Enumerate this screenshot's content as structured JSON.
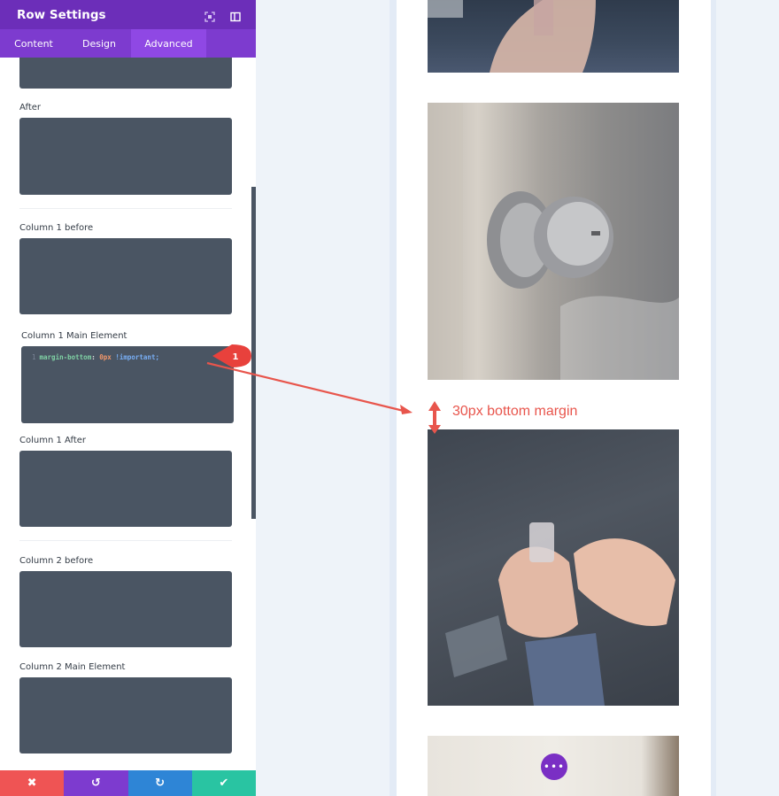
{
  "panel": {
    "title": "Row Settings",
    "header_icons": [
      "fullscreen-icon",
      "split-view-icon"
    ],
    "tabs": [
      {
        "label": "Content",
        "active": false
      },
      {
        "label": "Design",
        "active": false
      },
      {
        "label": "Advanced",
        "active": true
      }
    ],
    "fields": [
      {
        "label": "After",
        "value": ""
      },
      {
        "label": "Column 1 before",
        "value": ""
      },
      {
        "label": "Column 1 Main Element",
        "value": "margin-bottom: 0px !important;"
      },
      {
        "label": "Column 1 After",
        "value": ""
      },
      {
        "label": "Column 2 before",
        "value": ""
      },
      {
        "label": "Column 2 Main Element",
        "value": ""
      }
    ],
    "code": {
      "line_number": "1",
      "property": "margin-bottom",
      "colon": ":",
      "value": "0px",
      "important": "!important;"
    },
    "footer": {
      "cancel_icon": "✖",
      "undo_icon": "↺",
      "redo_icon": "↻",
      "save_icon": "✔"
    }
  },
  "annotation": {
    "marker": "1",
    "label": "30px bottom margin",
    "color": "#e8554c"
  },
  "preview": {
    "fab_label": "•••"
  },
  "colors": {
    "header": "#6c2eb9",
    "tabs": "#7d3bcf",
    "active_tab": "#8f48e4",
    "code_bg": "#4a5563",
    "cancel": "#ef5454",
    "undo": "#7d3bcf",
    "redo": "#2e85d6",
    "save": "#29c4a2"
  }
}
